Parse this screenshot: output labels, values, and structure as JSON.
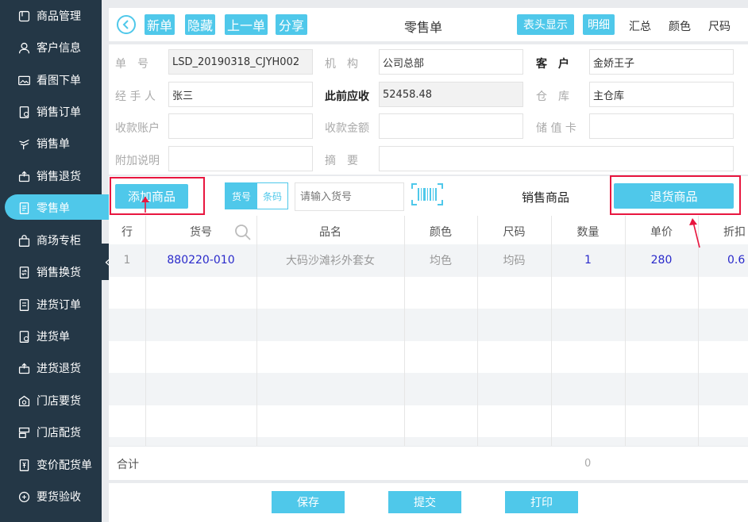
{
  "sidebar": {
    "items": [
      {
        "label": "商品管理",
        "icon": "box-icon"
      },
      {
        "label": "客户信息",
        "icon": "user-icon"
      },
      {
        "label": "看图下单",
        "icon": "image-icon"
      },
      {
        "label": "销售订单",
        "icon": "order-icon"
      },
      {
        "label": "销售单",
        "icon": "sale-icon"
      },
      {
        "label": "销售退货",
        "icon": "return-icon"
      },
      {
        "label": "零售单",
        "icon": "receipt-icon"
      },
      {
        "label": "商场专柜",
        "icon": "bag-icon"
      },
      {
        "label": "销售换货",
        "icon": "exchange-icon"
      },
      {
        "label": "进货订单",
        "icon": "purchase-order-icon"
      },
      {
        "label": "进货单",
        "icon": "purchase-icon"
      },
      {
        "label": "进货退货",
        "icon": "purchase-return-icon"
      },
      {
        "label": "门店要货",
        "icon": "store-icon"
      },
      {
        "label": "门店配货",
        "icon": "distribution-icon"
      },
      {
        "label": "变价配货单",
        "icon": "price-change-icon"
      },
      {
        "label": "要货验收",
        "icon": "inspect-icon"
      }
    ],
    "active_index": 6
  },
  "toolbar": {
    "new": "新单",
    "hide": "隐藏",
    "prev": "上一单",
    "share": "分享",
    "title": "零售单",
    "header_display": "表头显示",
    "detail": "明细",
    "summary": "汇总",
    "color": "颜色",
    "size": "尺码"
  },
  "form": {
    "order_no_label": "单　号",
    "order_no": "LSD_20190318_CJYH002",
    "org_label": "机　构",
    "org": "公司总部",
    "customer_label": "客　户",
    "customer": "金娇王子",
    "handler_label": "经 手 人",
    "handler": "张三",
    "prev_due_label": "此前应收",
    "prev_due": "52458.48",
    "warehouse_label": "仓　库",
    "warehouse": "主仓库",
    "account_label": "收款账户",
    "account": "",
    "amount_label": "收款金额",
    "amount": "",
    "stored_card_label": "储 值 卡",
    "stored_card": "",
    "note_label": "附加说明",
    "note": "",
    "summary_label": "摘　要",
    "summary": ""
  },
  "tools": {
    "add_goods": "添加商品",
    "seg_code": "货号",
    "seg_barcode": "条码",
    "search_placeholder": "请输入货号",
    "sale_goods": "销售商品",
    "return_goods": "退货商品"
  },
  "table": {
    "columns": [
      "行",
      "货号",
      "品名",
      "颜色",
      "尺码",
      "数量",
      "单价",
      "折扣"
    ],
    "rows": [
      {
        "line": "1",
        "code": "880220-010",
        "name": "大码沙滩衫外套女",
        "color": "均色",
        "size": "均码",
        "qty": "1",
        "price": "280",
        "discount": "0.6"
      }
    ]
  },
  "totals": {
    "label": "合计",
    "qty": "0"
  },
  "actions": {
    "save": "保存",
    "submit": "提交",
    "print": "打印"
  },
  "colors": {
    "accent": "#4fc8ea",
    "sidebar": "#243746",
    "highlight": "#e8163f",
    "link": "#2a2acb"
  }
}
